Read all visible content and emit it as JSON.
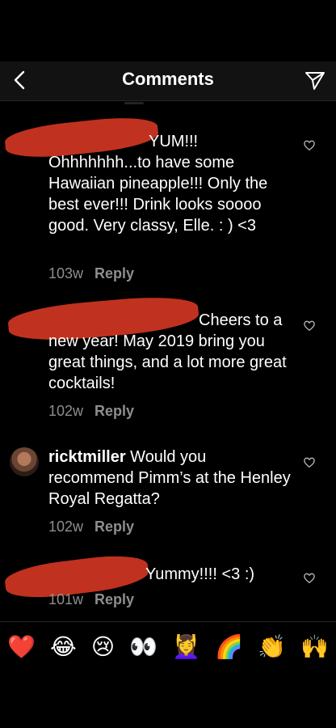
{
  "header": {
    "title": "Comments"
  },
  "comments": [
    {
      "username": "",
      "text": "YUM!!! Ohhhhhhh...to have some Hawaiian  pineapple!!! Only the best ever!!! Drink looks soooo good. Very classy, Elle. : ) <3",
      "time": "103w",
      "reply": "Reply"
    },
    {
      "username": "",
      "text": "Cheers to a new year! May 2019 bring you great things, and a lot more great cocktails!",
      "time": "102w",
      "reply": "Reply"
    },
    {
      "username": "ricktmiller",
      "text": "Would you recommend Pimm’s at the Henley Royal Regatta?",
      "time": "102w",
      "reply": "Reply"
    },
    {
      "username": "",
      "text": "Yummy!!!! <3 :)",
      "time": "101w",
      "reply": "Reply"
    }
  ],
  "emoji_bar": [
    "❤️",
    "😂",
    "😢",
    "👀",
    "💆‍♀️",
    "🌈",
    "👏",
    "🙌"
  ],
  "colors": {
    "background": "#000000",
    "muted": "#8e8e8e",
    "redaction": "#c0321f"
  }
}
